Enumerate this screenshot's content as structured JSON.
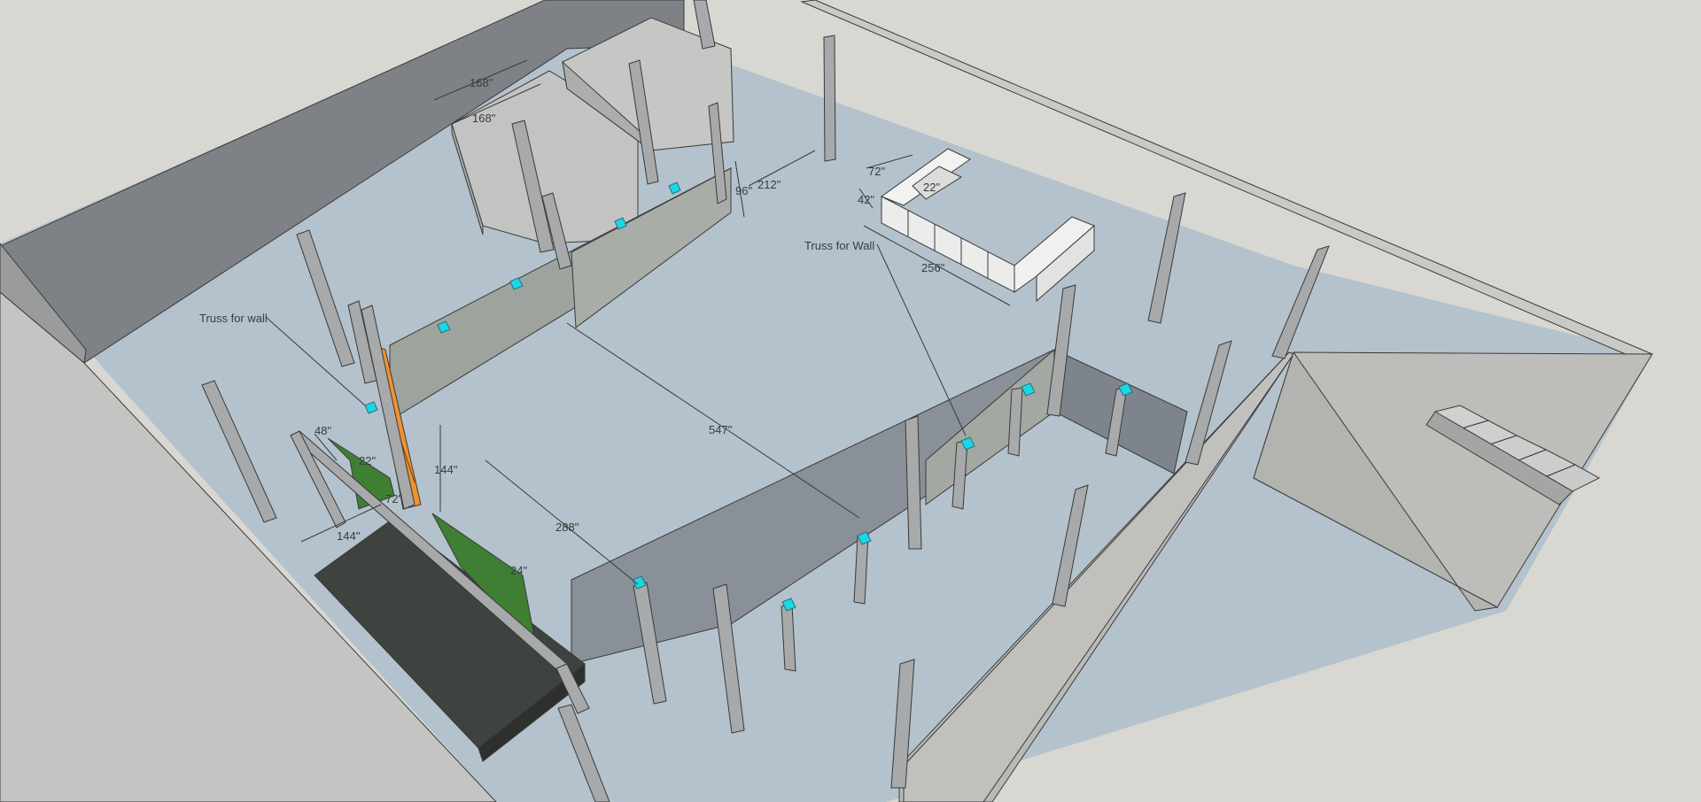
{
  "scene": {
    "colors": {
      "background": "#d8d7d2",
      "floor": "#b3c2cc",
      "outer_wall_dark": "#7e8287",
      "outer_wall_light": "#c2c2c0",
      "partition_wall": "#9ea39d",
      "column": "#a7a9ab",
      "column_cap": "#1ad7e6",
      "orange_truss": "#f0922e",
      "green_panel": "#3f7f33",
      "dark_platform": "#3e433f"
    },
    "annotations": [
      {
        "id": "truss-left",
        "text": "Truss for wall"
      },
      {
        "id": "truss-right",
        "text": "Truss for Wall"
      }
    ],
    "dimensions": [
      {
        "id": "dim-168-top",
        "text": "168\""
      },
      {
        "id": "dim-168-side",
        "text": "168\""
      },
      {
        "id": "dim-96",
        "text": "96\""
      },
      {
        "id": "dim-212",
        "text": "212\""
      },
      {
        "id": "dim-72-desk",
        "text": "72\""
      },
      {
        "id": "dim-42",
        "text": "42\""
      },
      {
        "id": "dim-22-desk",
        "text": "22\""
      },
      {
        "id": "dim-256",
        "text": "256\""
      },
      {
        "id": "dim-547",
        "text": "547\""
      },
      {
        "id": "dim-144-vert",
        "text": "144\""
      },
      {
        "id": "dim-288",
        "text": "288\""
      },
      {
        "id": "dim-48",
        "text": "48\""
      },
      {
        "id": "dim-22-left",
        "text": "22\""
      },
      {
        "id": "dim-72-left",
        "text": "72\""
      },
      {
        "id": "dim-144-bottom",
        "text": "144\""
      },
      {
        "id": "dim-24",
        "text": "24\""
      }
    ]
  }
}
